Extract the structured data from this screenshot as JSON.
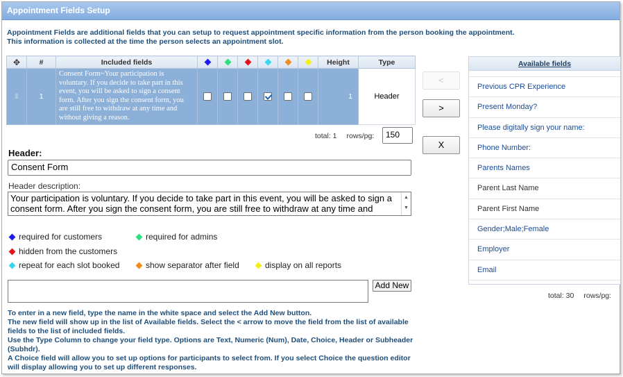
{
  "title": "Appointment Fields Setup",
  "intro": [
    "Appointment Fields are additional fields that you can setup to request appointment specific information from the person booking the appointment.",
    "This information is collected at the time the person selects an appointment slot."
  ],
  "grid": {
    "headers": {
      "move": "✥",
      "number": "#",
      "included": "Included fields",
      "height": "Height",
      "type": "Type"
    },
    "colors": [
      "#1d1df0",
      "#2edf7e",
      "#e3161e",
      "#35d8ef",
      "#f58a1f",
      "#f2ef1c"
    ],
    "row": {
      "number": "1",
      "description": "Consent Form~Your participation is voluntary. If you decide to take part in this event, you will be asked to sign a consent form. After you sign the consent form, you are still free to withdraw at any time and without giving a reason.",
      "checks": [
        false,
        false,
        false,
        true,
        false,
        false
      ],
      "height": "1",
      "type": "Header"
    }
  },
  "pager_left": {
    "total": "total: 1",
    "rows_label": "rows/pg:",
    "rows_value": "150"
  },
  "header_label": "Header:",
  "header_value": "Consent Form",
  "header_desc_label": "Header description:",
  "header_desc_value": "Your participation is voluntary. If you decide to take part in this event, you will be asked to sign a consent form. After you sign the consent form, you are still free to withdraw at any time and without giving a reason.",
  "legend": {
    "required_customers": "required for customers",
    "required_admins": "required for admins",
    "hidden": "hidden from the customers",
    "repeat": "repeat for each slot booked",
    "separator": "show separator after field",
    "display_reports": "display on all reports"
  },
  "add_new_label": "Add New",
  "help": [
    "To enter in a new field, type the name in the white space and select the Add New button.",
    "The new field will show up in the list of Available fields. Select the < arrow to move the field from the list of available fields to the list of included fields.",
    "Use the Type Column to change your field type. Options are Text, Numeric (Num), Date, Choice, Header or Subheader (Subhdr).",
    "A Choice field will allow you to set up options for participants to select from. If you select Choice the question editor will display allowing you to set up different responses."
  ],
  "buttons": {
    "move_left": "<",
    "move_right": ">",
    "remove": "X"
  },
  "available": {
    "header": "Available fields",
    "items": [
      {
        "label": "Previous CPR Experience",
        "link": true
      },
      {
        "label": "Present Monday?",
        "link": true
      },
      {
        "label": "Please digitally sign your name:",
        "link": true
      },
      {
        "label": "Phone Number:",
        "link": true
      },
      {
        "label": "Parents Names",
        "link": true
      },
      {
        "label": "Parent Last Name",
        "link": false
      },
      {
        "label": "Parent First Name",
        "link": false
      },
      {
        "label": "Gender;Male;Female",
        "link": true
      },
      {
        "label": "Employer",
        "link": true
      },
      {
        "label": "Email",
        "link": true
      }
    ],
    "total": "total: 30",
    "rows_label": "rows/pg:"
  }
}
